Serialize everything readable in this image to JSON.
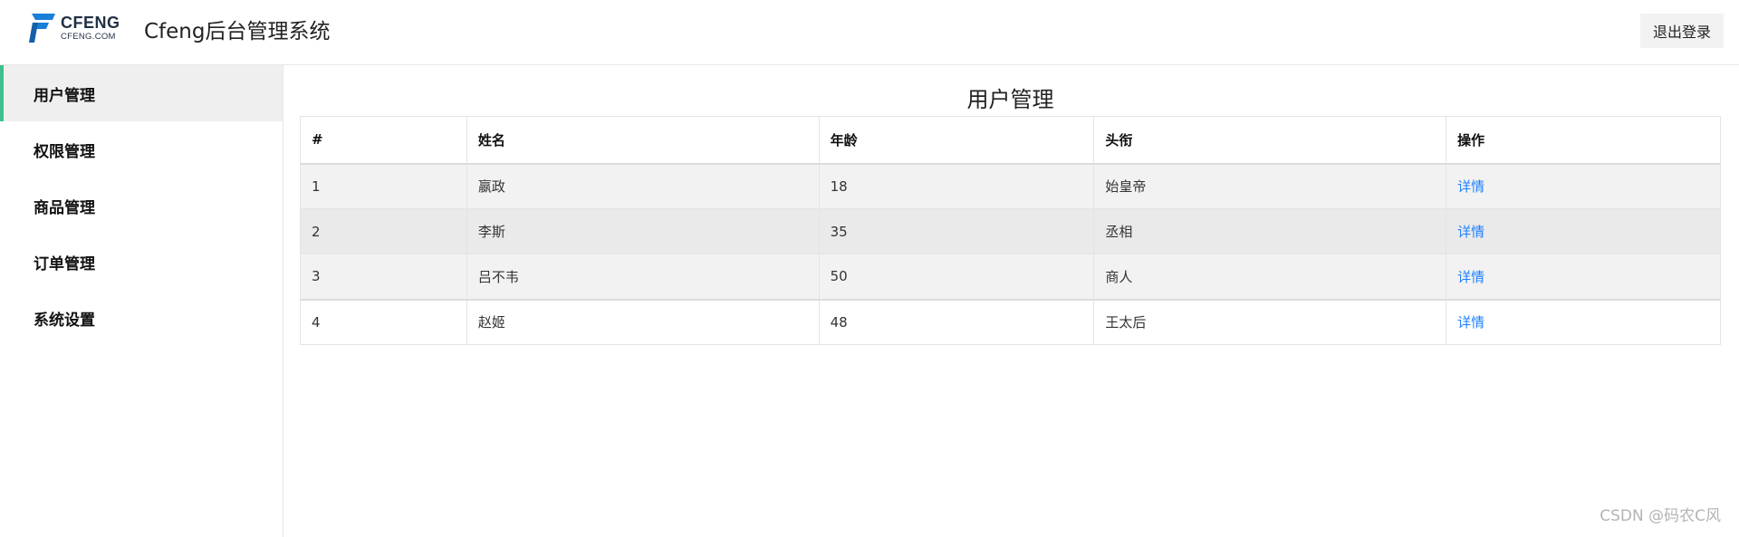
{
  "header": {
    "logo_big": "CFENG",
    "logo_small": "CFENG.COM",
    "title": "Cfeng后台管理系统",
    "logout_label": "退出登录"
  },
  "sidebar": {
    "items": [
      {
        "label": "用户管理",
        "active": true
      },
      {
        "label": "权限管理"
      },
      {
        "label": "商品管理"
      },
      {
        "label": "订单管理"
      },
      {
        "label": "系统设置"
      }
    ]
  },
  "main": {
    "title": "用户管理",
    "table": {
      "columns": [
        "#",
        "姓名",
        "年龄",
        "头衔",
        "操作"
      ],
      "rows": [
        {
          "id": "1",
          "name": "嬴政",
          "age": "18",
          "title": "始皇帝",
          "action": "详情"
        },
        {
          "id": "2",
          "name": "李斯",
          "age": "35",
          "title": "丞相",
          "action": "详情"
        },
        {
          "id": "3",
          "name": "吕不韦",
          "age": "50",
          "title": "商人",
          "action": "详情"
        },
        {
          "id": "4",
          "name": "赵姬",
          "age": "48",
          "title": "王太后",
          "action": "详情"
        }
      ]
    }
  },
  "watermark": "CSDN @码农C风",
  "colors": {
    "accent": "#3cc08e",
    "link": "#1e80ff",
    "logo_blue": "#1a7fd8",
    "logo_dark": "#1f2f44"
  },
  "icons": {
    "logo": "cfeng-logo-icon"
  }
}
